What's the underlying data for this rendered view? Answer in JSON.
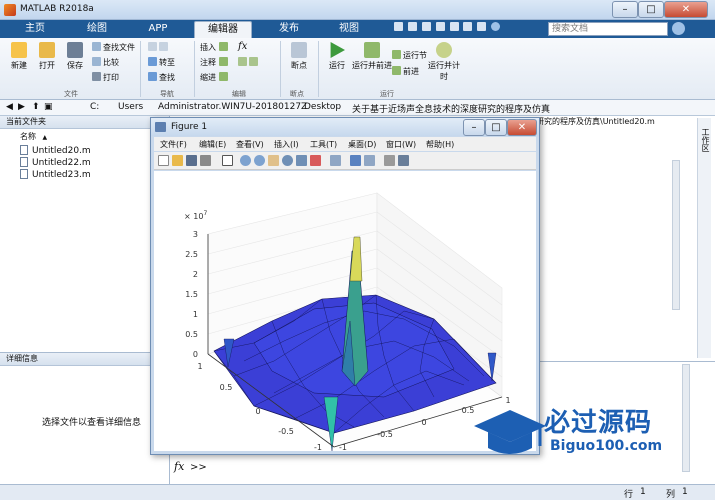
{
  "window": {
    "title": "MATLAB R2018a",
    "minimize": "–",
    "maximize": "□",
    "close": "✕"
  },
  "tabs": [
    "主页",
    "绘图",
    "APP",
    "编辑器",
    "发布",
    "视图"
  ],
  "search": {
    "placeholder": "搜索文档"
  },
  "ribbon": {
    "file": {
      "new": "新建",
      "open": "打开",
      "save": "保存",
      "find_files": "查找文件",
      "compare": "比较",
      "print": "打印",
      "group": "文件"
    },
    "nav": {
      "goto": "转至",
      "find": "查找",
      "group": "导航"
    },
    "edit": {
      "insert": "插入",
      "comment": "注释",
      "indent": "缩进",
      "fx": "fx",
      "group": "编辑"
    },
    "bp": {
      "breakpoints": "断点",
      "group": "断点"
    },
    "run": {
      "run": "运行",
      "run_advance": "运行并前进",
      "run_section": "运行节",
      "advance": "前进",
      "run_time": "运行并计时",
      "group": "运行"
    }
  },
  "address": {
    "parts": [
      "C:",
      "Users",
      "Administrator.WIN7U-20180127Z",
      "Desktop",
      "关于基于近场声全息技术的深度研究的程序及仿真"
    ]
  },
  "current_folder": {
    "title": "当前文件夹",
    "col_name": "名称",
    "sort": "▲",
    "files": [
      "Untitled20.m",
      "Untitled22.m",
      "Untitled23.m"
    ]
  },
  "details": {
    "title": "详细信息",
    "message": "选择文件以查看详细信息"
  },
  "editor": {
    "tab_path": "研究的程序及仿真\\Untitled20.m",
    "side_label": "工作区"
  },
  "command": {
    "fx": "fx",
    "prompt": ">>"
  },
  "status": {
    "row_label": "行",
    "row": "1",
    "col_label": "列",
    "col": "1"
  },
  "figure": {
    "title": "Figure 1",
    "menu": [
      "文件(F)",
      "编辑(E)",
      "查看(V)",
      "插入(I)",
      "工具(T)",
      "桌面(D)",
      "窗口(W)",
      "帮助(H)"
    ],
    "plot": {
      "z_exponent_base": "× 10",
      "z_exponent_power": "7",
      "z_ticks": [
        "0",
        "0.5",
        "1",
        "1.5",
        "2",
        "2.5",
        "3"
      ],
      "x_ticks": [
        "1",
        "0.5",
        "0",
        "-0.5",
        "-1"
      ],
      "y_ticks": [
        "-1",
        "-0.5",
        "0",
        "0.5",
        "1"
      ]
    }
  },
  "watermark": {
    "brand": "必过源码",
    "url": "Biguo100.com"
  },
  "colors": {
    "tabbar": "#1f5a96",
    "surface": "#3a3fd8",
    "peak": "#e6d84a"
  }
}
